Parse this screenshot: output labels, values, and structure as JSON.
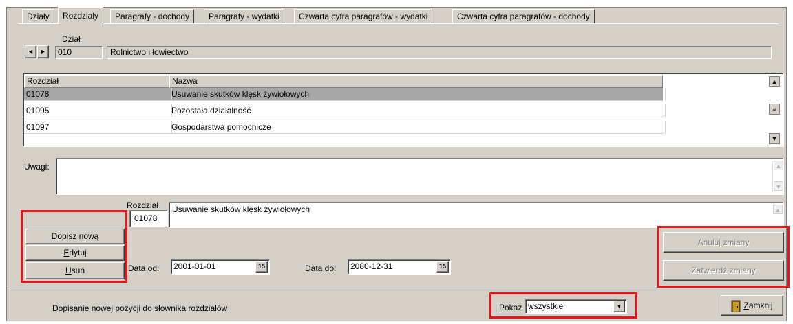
{
  "tabs": [
    "Działy",
    "Rozdziały",
    "Paragrafy - dochody",
    "Paragrafy - wydatki",
    "Czwarta cyfra paragrafów - wydatki",
    "Czwarta cyfra paragrafów - dochody"
  ],
  "dzial": {
    "label": "Dział",
    "code": "010",
    "name": "Rolnictwo i łowiectwo",
    "nav_prev": "◄",
    "nav_next": "►"
  },
  "grid": {
    "columns": [
      "Rozdział",
      "Nazwa"
    ],
    "rows": [
      {
        "code": "01078",
        "name": "Usuwanie skutków klęsk żywiołowych"
      },
      {
        "code": "01095",
        "name": "Pozostała działalność"
      },
      {
        "code": "01097",
        "name": "Gospodarstwa pomocnicze"
      }
    ],
    "selected_index": 0
  },
  "uwagi": {
    "label": "Uwagi:",
    "value": ""
  },
  "rozdzial": {
    "label": "Rozdział",
    "code": "01078",
    "name": "Usuwanie skutków klęsk żywiołowych"
  },
  "buttons": {
    "add": {
      "pre": "",
      "key": "D",
      "post": "opisz nową"
    },
    "edit": {
      "pre": "",
      "key": "E",
      "post": "dytuj"
    },
    "delete": {
      "pre": "",
      "key": "U",
      "post": "suń"
    },
    "cancel": "Anuluj zmiany",
    "confirm": "Zatwierdź zmiany",
    "close": {
      "pre": "",
      "key": "Z",
      "post": "amknij"
    }
  },
  "dates": {
    "from_label": "Data od:",
    "from_value": "2001-01-01",
    "to_label": "Data do:",
    "to_value": "2080-12-31",
    "calendar_glyph": "15"
  },
  "status_text": "Dopisanie nowej pozycji do słownika rozdziałów",
  "filter": {
    "label": "Pokaż",
    "value": "wszystkie"
  },
  "colors": {
    "highlight": "#e8161a",
    "face": "#d4d0c8",
    "selected_row": "#a6a6a6"
  }
}
